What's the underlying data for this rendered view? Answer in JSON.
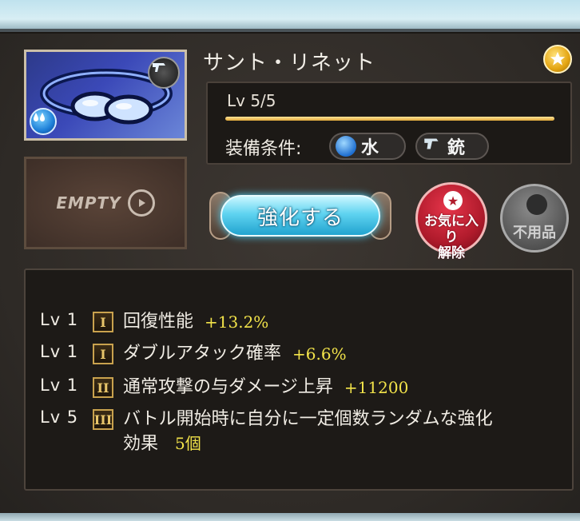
{
  "item": {
    "name": "サント・リネット",
    "empty_label": "EMPTY",
    "level": "Lv 5/5",
    "level_progress": 1.0,
    "requirements_label": "装備条件:",
    "requirements": [
      {
        "icon": "water-orb-icon",
        "label": "水"
      },
      {
        "icon": "gun-icon",
        "label": "銃"
      }
    ]
  },
  "actions": {
    "upgrade_label": "強化する",
    "fav_release_label": "お気に入り解除",
    "unused_label": "不用品"
  },
  "skills": [
    {
      "lv": "Lv 1",
      "rank": "I",
      "name": "回復性能",
      "value": "+13.2%"
    },
    {
      "lv": "Lv 1",
      "rank": "I",
      "name": "ダブルアタック確率",
      "value": "+6.6%"
    },
    {
      "lv": "Lv 1",
      "rank": "II",
      "name": "通常攻撃の与ダメージ上昇",
      "value": "+11200"
    },
    {
      "lv": "Lv 5",
      "rank": "III",
      "name": "バトル開始時に自分に一定個数ランダムな強化",
      "name2": "効果",
      "value": "5個"
    }
  ],
  "colors": {
    "accent_value": "#f2e34a",
    "upgrade_button": "#5fd3f0",
    "fav_button": "#b01b2c"
  }
}
